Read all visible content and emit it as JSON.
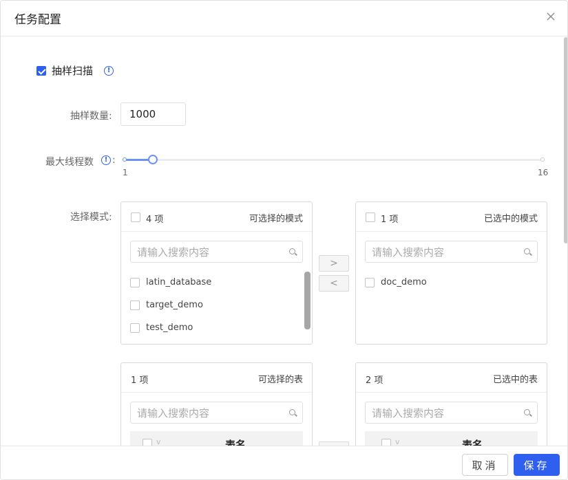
{
  "dialog": {
    "title": "任务配置",
    "cancel_label": "取消",
    "save_label": "保存"
  },
  "sampling": {
    "label": "抽样扫描",
    "checked": true
  },
  "sample_count": {
    "label": "抽样数量:",
    "value": "1000"
  },
  "max_threads": {
    "label": "最大线程数",
    "colon": ":",
    "min": "1",
    "max": "16",
    "value": 3
  },
  "schema_mode": {
    "label": "选择模式:",
    "left": {
      "count": "4 项",
      "title": "可选择的模式",
      "search_placeholder": "请输入搜索内容",
      "items": [
        "latin_database",
        "target_demo",
        "test_demo"
      ]
    },
    "right": {
      "count": "1 项",
      "title": "已选中的模式",
      "search_placeholder": "请输入搜索内容",
      "items": [
        "doc_demo"
      ]
    },
    "move_right": ">",
    "move_left": "<"
  },
  "table_mode": {
    "left": {
      "count": "1 项",
      "title": "可选择的表",
      "search_placeholder": "请输入搜索内容",
      "column_header": "表名"
    },
    "right": {
      "count": "2 项",
      "title": "已选中的表",
      "search_placeholder": "请输入搜索内容",
      "column_header": "表名"
    }
  },
  "colors": {
    "primary": "#2f5fef",
    "slider": "#6c91f7"
  }
}
